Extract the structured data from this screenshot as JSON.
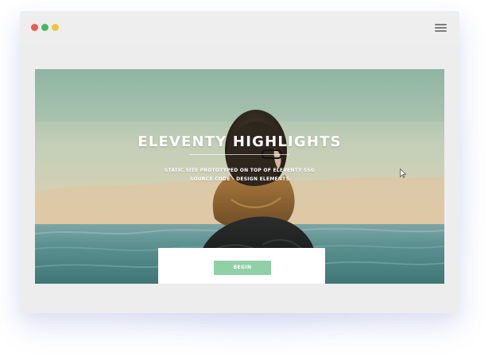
{
  "browser": {
    "window_controls": [
      "close",
      "minimize",
      "maximize"
    ],
    "menu_icon": "hamburger-menu-icon"
  },
  "hero": {
    "title": "ELEVENTY HIGHLIGHTS",
    "subtitle_line_1": "STATIC SITE PROTOTYPED ON TOP OF ELEVENTY SSG",
    "subtitle_line_2": "SOURCE CODE - DESIGN ELEMENTS",
    "button_label": "BEGIN"
  },
  "colors": {
    "accent": "#8fd0a7",
    "close": "#f05a4f",
    "green": "#49b66a",
    "yellow": "#f3c23d",
    "sky_top": "#8fb4a4",
    "sea": "#427e7d"
  }
}
